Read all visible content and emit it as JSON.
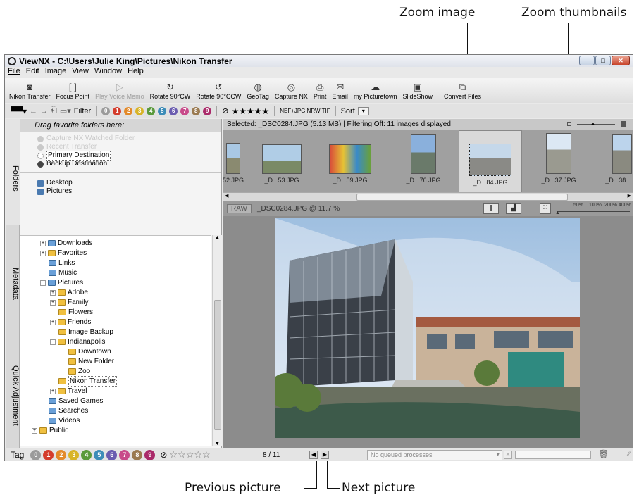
{
  "callouts": {
    "zoom_image": "Zoom image",
    "zoom_thumbnails": "Zoom thumbnails",
    "previous_picture": "Previous picture",
    "next_picture": "Next picture"
  },
  "window": {
    "title": "ViewNX - C:\\Users\\Julie King\\Pictures\\Nikon Transfer",
    "menu": [
      "File",
      "Edit",
      "Image",
      "View",
      "Window",
      "Help"
    ]
  },
  "toolbar": {
    "nikon_transfer": "Nikon Transfer",
    "focus_point": "Focus Point",
    "play_voice_memo": "Play Voice Memo",
    "rotate_cw": "Rotate 90°CW",
    "rotate_ccw": "Rotate 90°CCW",
    "geotag": "GeoTag",
    "capture_nx": "Capture NX",
    "print": "Print",
    "email": "Email",
    "my_picturetown": "my Picturetown",
    "slideshow": "SlideShow",
    "convert_files": "Convert Files"
  },
  "filterbar": {
    "filter_label": "Filter",
    "labels": [
      "0",
      "1",
      "2",
      "3",
      "4",
      "5",
      "6",
      "7",
      "8",
      "9"
    ],
    "stars": "★★★★★",
    "format": "NEF+JPG|NRW|TIF",
    "sort_label": "Sort"
  },
  "sidetabs": {
    "folders": "Folders",
    "metadata": "Metadata",
    "quick_adjustment": "Quick Adjustment"
  },
  "favorites": {
    "header": "Drag favorite folders here:",
    "items": [
      "Capture NX Watched Folder",
      "Recent Transfer",
      "Primary Destination",
      "Backup Destination"
    ],
    "locations": [
      "Desktop",
      "Pictures"
    ]
  },
  "tree": [
    "Downloads",
    "Favorites",
    "Links",
    "Music",
    "Pictures",
    "Adobe",
    "Family",
    "Flowers",
    "Friends",
    "Image Backup",
    "Indianapolis",
    "Downtown",
    "New Folder",
    "Zoo",
    "Nikon Transfer",
    "Travel",
    "Saved Games",
    "Searches",
    "Videos",
    "Public"
  ],
  "main": {
    "status": "Selected: _DSC0284.JPG (5.13 MB) | Filtering Off: 11 images displayed",
    "thumbnails": [
      "52.JPG",
      "_D...53.JPG",
      "_D...59.JPG",
      "_D...76.JPG",
      "_D...84.JPG",
      "_D...37.JPG",
      "_D...38."
    ],
    "raw_label": "RAW",
    "viewer_file": "_DSC0284.JPG @ 11.7 %",
    "zoom_levels": [
      "50%",
      "100%",
      "200%",
      "400%"
    ]
  },
  "tagbar": {
    "tag_label": "Tag",
    "labels": [
      "0",
      "1",
      "2",
      "3",
      "4",
      "5",
      "6",
      "7",
      "8",
      "9"
    ],
    "counter": "8 / 11",
    "queue": "No queued processes"
  },
  "colors": {
    "label_colors": [
      "#9a9a9a",
      "#d43c2c",
      "#e38a2a",
      "#d8b428",
      "#5a9a3c",
      "#3c8cb8",
      "#6a5cb0",
      "#c84a8a",
      "#9a7a50",
      "#aa2a6a"
    ]
  }
}
